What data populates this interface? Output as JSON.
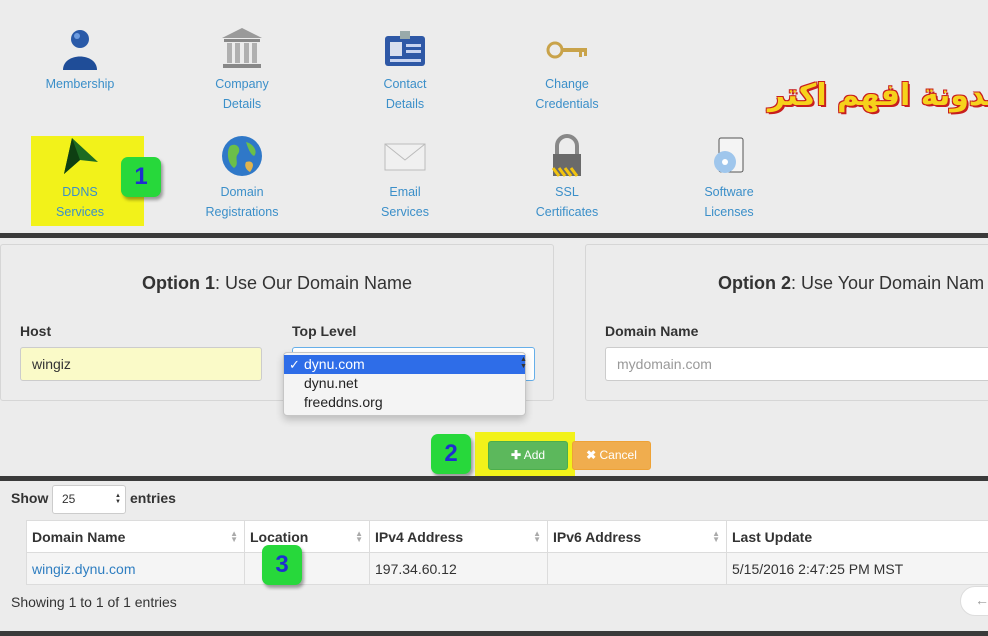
{
  "icons_row1": [
    {
      "name": "membership-icon",
      "label1": "Membership",
      "label2": ""
    },
    {
      "name": "company-details-icon",
      "label1": "Company",
      "label2": "Details"
    },
    {
      "name": "contact-details-icon",
      "label1": "Contact",
      "label2": "Details"
    },
    {
      "name": "change-credentials-icon",
      "label1": "Change",
      "label2": "Credentials"
    }
  ],
  "icons_row2": [
    {
      "name": "ddns-services-icon",
      "label1": "DDNS",
      "label2": "Services"
    },
    {
      "name": "domain-registrations-icon",
      "label1": "Domain",
      "label2": "Registrations"
    },
    {
      "name": "email-services-icon",
      "label1": "Email",
      "label2": "Services"
    },
    {
      "name": "ssl-certificates-icon",
      "label1": "SSL",
      "label2": "Certificates"
    },
    {
      "name": "software-licenses-icon",
      "label1": "Software",
      "label2": "Licenses"
    }
  ],
  "watermark": "مدونة افهم اكتر",
  "badges": {
    "b1": "1",
    "b2": "2",
    "b3": "3"
  },
  "option1": {
    "title_bold": "Option 1",
    "title_rest": ": Use Our Domain Name",
    "host_label": "Host",
    "host_value": "wingiz",
    "top_label": "Top Level",
    "dropdown": [
      "dynu.com",
      "dynu.net",
      "freeddns.org"
    ],
    "selected": "dynu.com"
  },
  "option2": {
    "title_bold": "Option 2",
    "title_rest": ": Use Your Domain Nam",
    "domain_label": "Domain Name",
    "domain_placeholder": "mydomain.com"
  },
  "actions": {
    "add": "Add",
    "cancel": "Cancel"
  },
  "table": {
    "show_label": "Show",
    "show_value": "25",
    "entries_label": "entries",
    "columns": [
      "Domain Name",
      "Location",
      "IPv4 Address",
      "IPv6 Address",
      "Last Update"
    ],
    "rows": [
      [
        "wingiz.dynu.com",
        "",
        "197.34.60.12",
        "",
        "5/15/2016 2:47:25 PM MST"
      ]
    ],
    "footer": "Showing 1 to 1 of 1 entries"
  },
  "colors": {
    "accent": "#3b8fc9",
    "highlight": "#f2f21a",
    "badge": "#27d83b",
    "add": "#5cb85c",
    "cancel": "#f0ad4e"
  }
}
